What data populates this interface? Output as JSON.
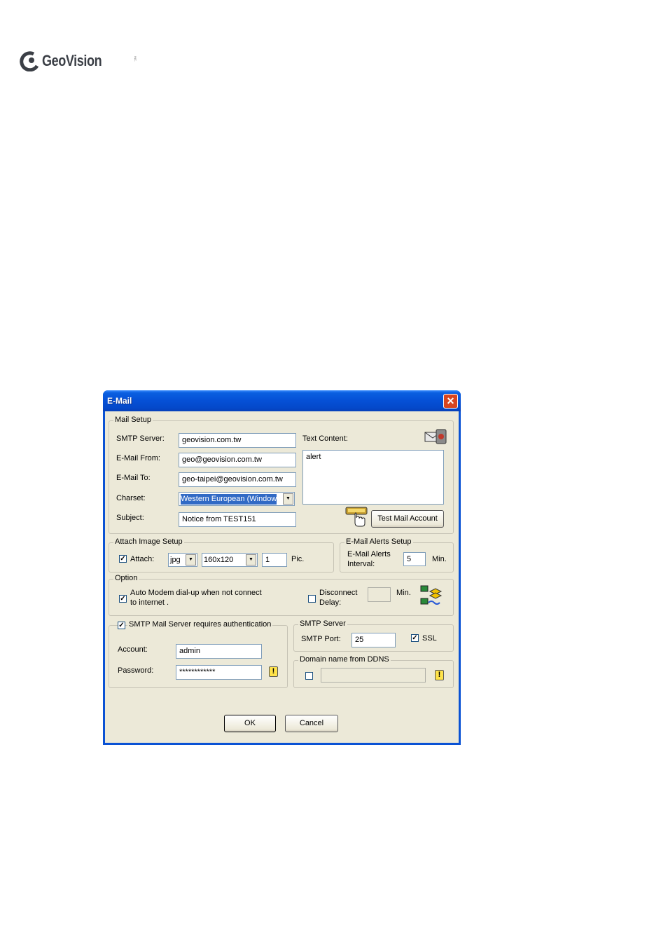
{
  "brand": {
    "name": "GeoVision",
    "tm": "INC."
  },
  "dialog": {
    "title": "E-Mail",
    "mail_setup": {
      "legend": "Mail Setup",
      "smtp_server_label": "SMTP Server:",
      "smtp_server_value": "geovision.com.tw",
      "email_from_label": "E-Mail From:",
      "email_from_value": "geo@geovision.com.tw",
      "email_to_label": "E-Mail To:",
      "email_to_value": "geo-taipei@geovision.com.tw",
      "charset_label": "Charset:",
      "charset_value": "Western European (Window",
      "subject_label": "Subject:",
      "subject_value": "Notice from TEST151",
      "text_content_label": "Text Content:",
      "text_content_value": "alert",
      "test_button": "Test Mail Account"
    },
    "attach": {
      "legend": "Attach Image Setup",
      "attach_label": "Attach:",
      "attach_checked": true,
      "format": "jpg",
      "size": "160x120",
      "count": "1",
      "pic_label": "Pic."
    },
    "alerts": {
      "legend": "E-Mail Alerts Setup",
      "interval_label_1": "E-Mail Alerts",
      "interval_label_2": "Interval:",
      "interval_value": "5",
      "min_label": "Min."
    },
    "option": {
      "legend": "Option",
      "modem_label_1": "Auto Modem dial-up when not connect",
      "modem_label_2": "to internet .",
      "modem_checked": true,
      "disconnect_label_1": "Disconnect",
      "disconnect_label_2": "Delay:",
      "disconnect_value": "",
      "min_label": "Min."
    },
    "auth": {
      "legend": "SMTP Mail Server requires authentication",
      "checked": true,
      "account_label": "Account:",
      "account_value": "admin",
      "password_label": "Password:",
      "password_value": "************"
    },
    "smtp_server": {
      "legend": "SMTP Server",
      "port_label": "SMTP Port:",
      "port_value": "25",
      "ssl_label": "SSL",
      "ssl_checked": true
    },
    "ddns": {
      "legend": "Domain name from DDNS",
      "checked": false,
      "value": ""
    },
    "ok": "OK",
    "cancel": "Cancel"
  }
}
